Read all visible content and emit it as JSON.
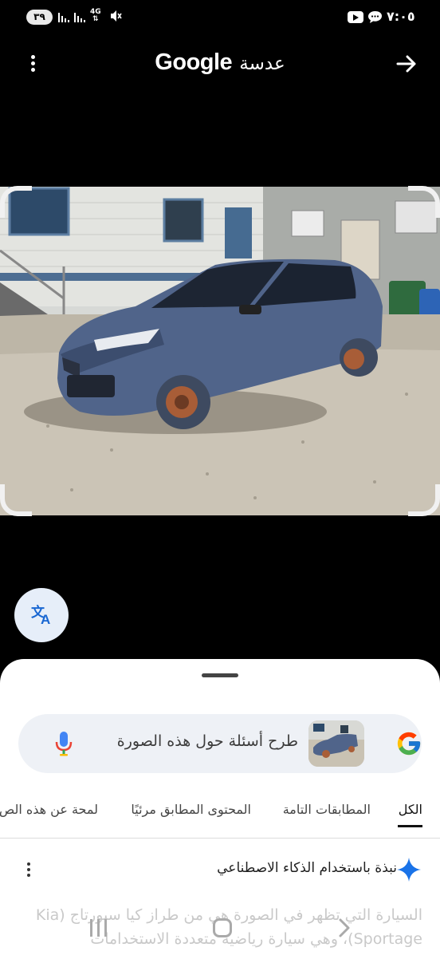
{
  "status_bar": {
    "battery": "٣٩",
    "network": "4G",
    "time": "٧:٠٥",
    "icons": [
      "signal-icon",
      "signal-icon",
      "network-4g-icon",
      "mute-icon",
      "youtube-icon",
      "chat-icon"
    ]
  },
  "header": {
    "brand": "Google",
    "app_name": "عدسة",
    "icons": [
      "more-vertical-icon",
      "arrow-right-icon"
    ]
  },
  "translate": {
    "icon": "translate-icon"
  },
  "search": {
    "placeholder": "طرح أسئلة حول هذه الصورة",
    "icons": [
      "google-icon",
      "mic-icon"
    ]
  },
  "tabs": [
    {
      "label": "الكل",
      "active": true
    },
    {
      "label": "المطابقات التامة",
      "active": false
    },
    {
      "label": "المحتوى المطابق مرئيًا",
      "active": false
    },
    {
      "label": "لمحة عن هذه الص",
      "active": false
    }
  ],
  "ai_overview": {
    "title": "نبذة باستخدام الذكاء الاصطناعي",
    "text": "السيارة التي تظهر في الصورة هي من طراز كيا سبورتاج (Kia Sportage)، وهي سيارة رياضية متعددة الاستخدامات",
    "accent": "#1a73e8"
  },
  "nav_bar": {
    "icons": [
      "recents-icon",
      "home-icon",
      "back-icon"
    ]
  }
}
